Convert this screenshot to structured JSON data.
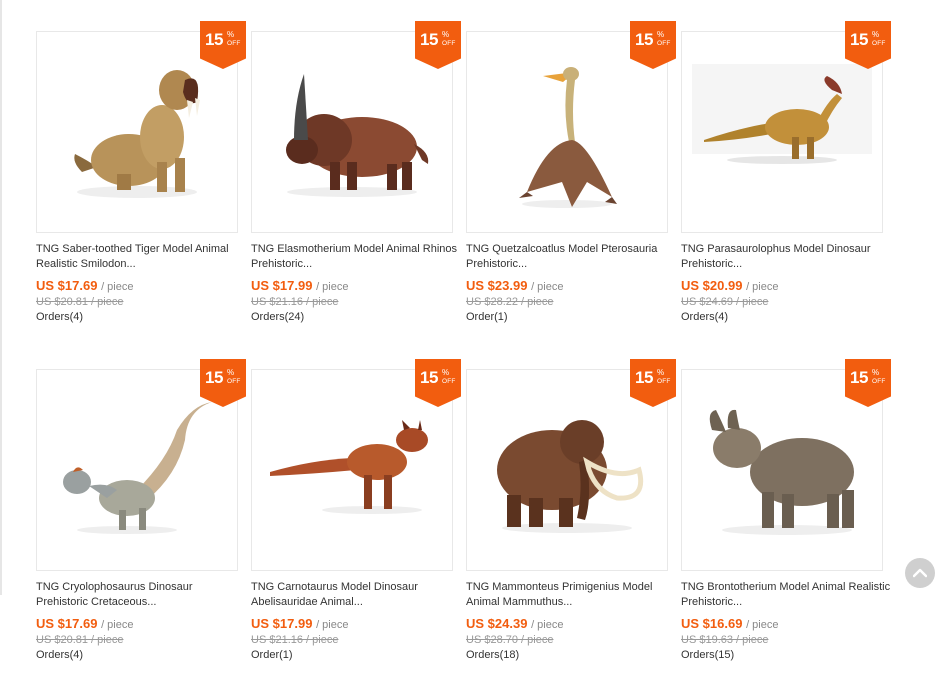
{
  "products": [
    {
      "title": "TNG Saber-toothed Tiger Model Animal Realistic Smilodon...",
      "price": "US $17.69",
      "unit": "/ piece",
      "original": "US $20.81 / piece",
      "orders": "Orders(4)",
      "discount": "15",
      "discount_pct": "%",
      "discount_off": "OFF",
      "image": "saber-toothed-tiger"
    },
    {
      "title": "TNG Elasmotherium Model Animal Rhinos Prehistoric...",
      "price": "US $17.99",
      "unit": "/ piece",
      "original": "US $21.16 / piece",
      "orders": "Orders(24)",
      "discount": "15",
      "discount_pct": "%",
      "discount_off": "OFF",
      "image": "elasmotherium"
    },
    {
      "title": "TNG Quetzalcoatlus Model Pterosauria Prehistoric...",
      "price": "US $23.99",
      "unit": "/ piece",
      "original": "US $28.22 / piece",
      "orders": "Order(1)",
      "discount": "15",
      "discount_pct": "%",
      "discount_off": "OFF",
      "image": "quetzalcoatlus"
    },
    {
      "title": "TNG Parasaurolophus Model Dinosaur Prehistoric...",
      "price": "US $20.99",
      "unit": "/ piece",
      "original": "US $24.69 / piece",
      "orders": "Orders(4)",
      "discount": "15",
      "discount_pct": "%",
      "discount_off": "OFF",
      "image": "parasaurolophus"
    },
    {
      "title": "TNG Cryolophosaurus Dinosaur Prehistoric Cretaceous...",
      "price": "US $17.69",
      "unit": "/ piece",
      "original": "US $20.81 / piece",
      "orders": "Orders(4)",
      "discount": "15",
      "discount_pct": "%",
      "discount_off": "OFF",
      "image": "cryolophosaurus"
    },
    {
      "title": "TNG Carnotaurus Model Dinosaur Abelisauridae Animal...",
      "price": "US $17.99",
      "unit": "/ piece",
      "original": "US $21.16 / piece",
      "orders": "Order(1)",
      "discount": "15",
      "discount_pct": "%",
      "discount_off": "OFF",
      "image": "carnotaurus"
    },
    {
      "title": "TNG Mammonteus Primigenius Model Animal Mammuthus...",
      "price": "US $24.39",
      "unit": "/ piece",
      "original": "US $28.70 / piece",
      "orders": "Orders(18)",
      "discount": "15",
      "discount_pct": "%",
      "discount_off": "OFF",
      "image": "mammoth"
    },
    {
      "title": "TNG Brontotherium Model Animal Realistic Prehistoric...",
      "price": "US $16.69",
      "unit": "/ piece",
      "original": "US $19.63 / piece",
      "orders": "Orders(15)",
      "discount": "15",
      "discount_pct": "%",
      "discount_off": "OFF",
      "image": "brontotherium"
    }
  ],
  "colors": {
    "accent": "#f25d0f",
    "text": "#333333",
    "muted": "#999999"
  },
  "back_to_top_icon": "chevron-up-icon"
}
